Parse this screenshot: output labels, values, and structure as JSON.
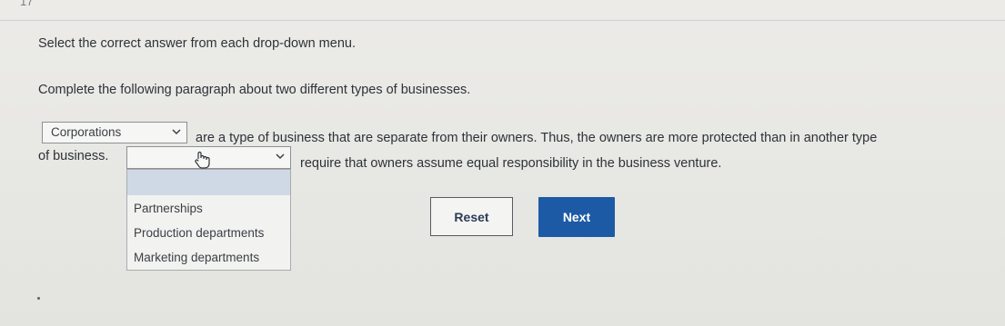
{
  "header": {
    "page_marker": "17"
  },
  "instruction": "Select the correct answer from each drop-down menu.",
  "prompt": "Complete the following paragraph about two different types of businesses.",
  "paragraph": {
    "line_1_text": "are a type of business that are separate from their owners. Thus, the owners are more protected than in another type",
    "line_2_prefix": "of business.",
    "line_2_suffix": "require that owners assume equal responsibility in the business venture."
  },
  "dropdown_1": {
    "selected": "Corporations"
  },
  "dropdown_2": {
    "selected": "",
    "options": [
      "Partnerships",
      "Production departments",
      "Marketing departments"
    ]
  },
  "buttons": {
    "reset": "Reset",
    "next": "Next"
  },
  "colors": {
    "next_button": "#1d5aa5",
    "highlight": "#cfd9e6"
  }
}
